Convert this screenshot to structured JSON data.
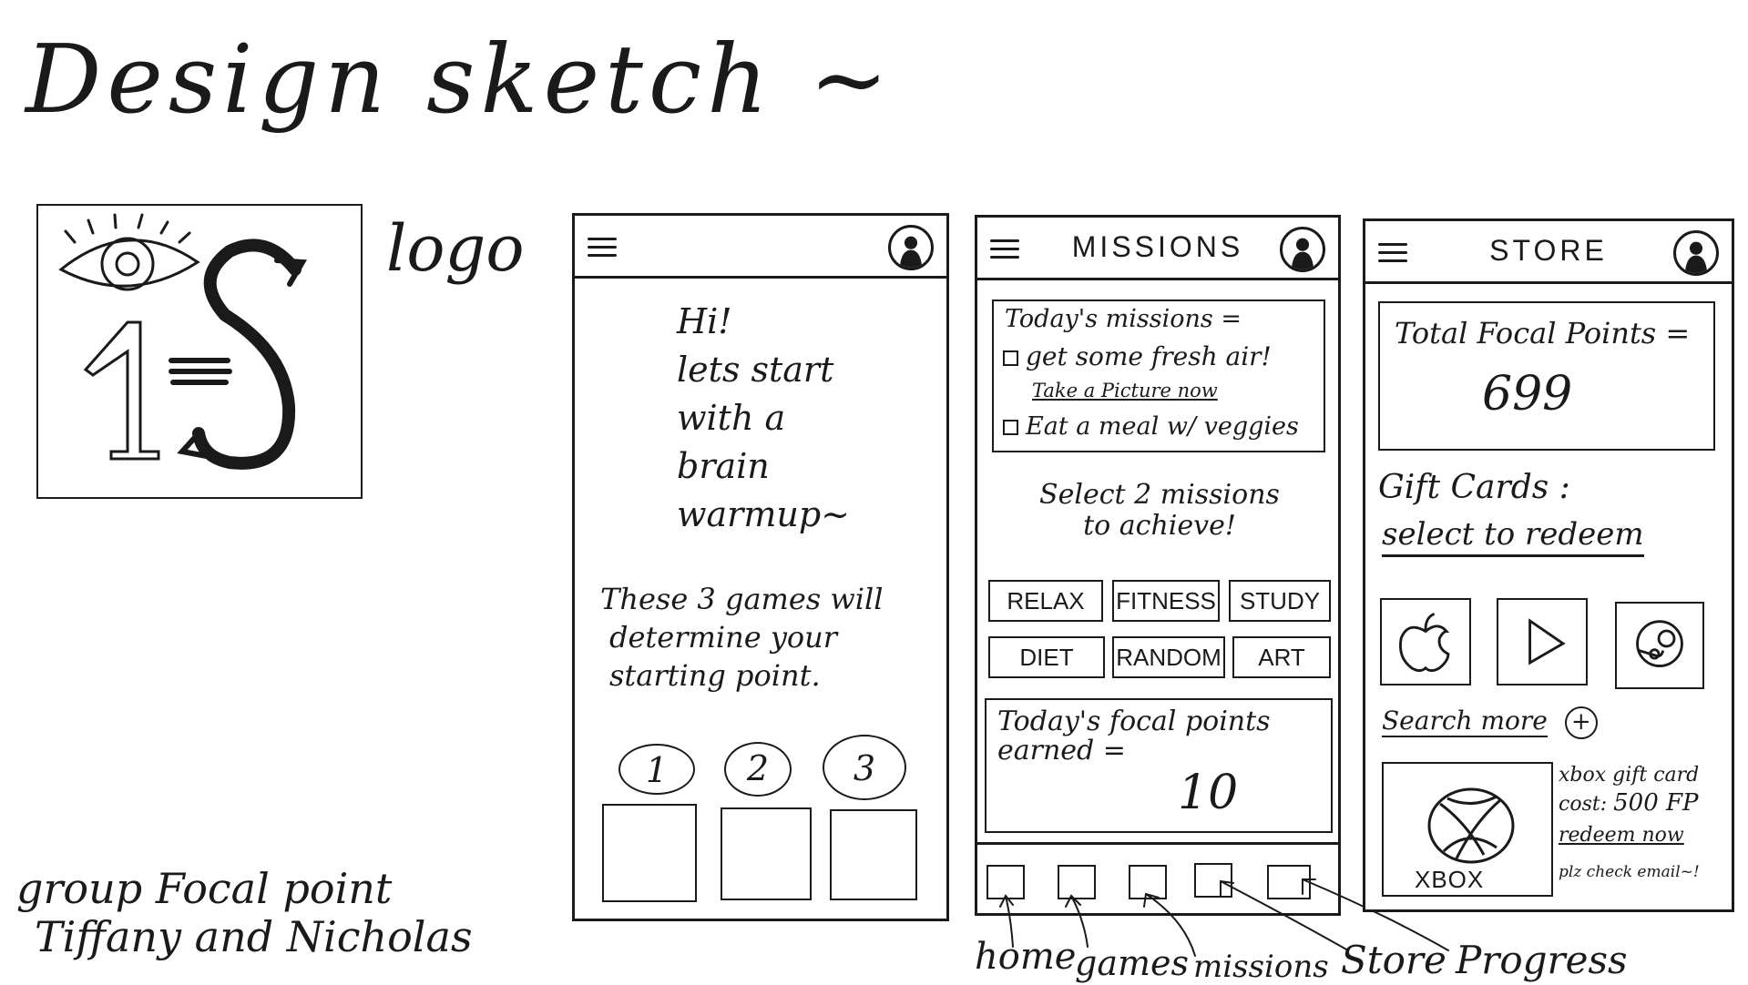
{
  "page_title": "Design sketch ~",
  "logo": {
    "label": "logo"
  },
  "credits": {
    "line1": "group Focal point",
    "line2": "Tiffany and Nicholas"
  },
  "welcome_screen": {
    "greeting": [
      "Hi!",
      "lets start",
      "with a",
      "brain",
      "warmup~"
    ],
    "info": [
      "These 3 games will",
      "determine your",
      "starting point."
    ],
    "games": [
      "1",
      "2",
      "3"
    ]
  },
  "missions_screen": {
    "title": "MISSIONS",
    "today_heading": "Today's missions =",
    "missions": [
      {
        "label": "get some fresh air!",
        "action": "Take a Picture now"
      },
      {
        "label": "Eat a meal w/ veggies"
      }
    ],
    "select_prompt": [
      "Select 2 missions",
      "to achieve!"
    ],
    "categories": [
      "RELAX",
      "FITNESS",
      "STUDY",
      "DIET",
      "RANDOM",
      "ART"
    ],
    "earned_label": [
      "Today's focal points",
      "earned ="
    ],
    "earned_value": "10"
  },
  "bottom_nav": {
    "labels": [
      "home",
      "games",
      "missions",
      "Store",
      "Progress"
    ]
  },
  "store_screen": {
    "title": "STORE",
    "total_label": "Total Focal Points =",
    "total_value": "699",
    "gift_heading": "Gift Cards :",
    "gift_sub": "select to redeem",
    "gift_icons": [
      "apple-icon",
      "google-play-icon",
      "steam-icon"
    ],
    "search_more": "Search more",
    "featured": {
      "brand": "XBOX",
      "title": "xbox gift card",
      "cost_label": "cost:",
      "cost_value": "500 FP",
      "redeem": "redeem now",
      "note": "plz check email~!"
    }
  },
  "colors": {
    "ink": "#1a1a1a",
    "paper": "#ffffff"
  }
}
